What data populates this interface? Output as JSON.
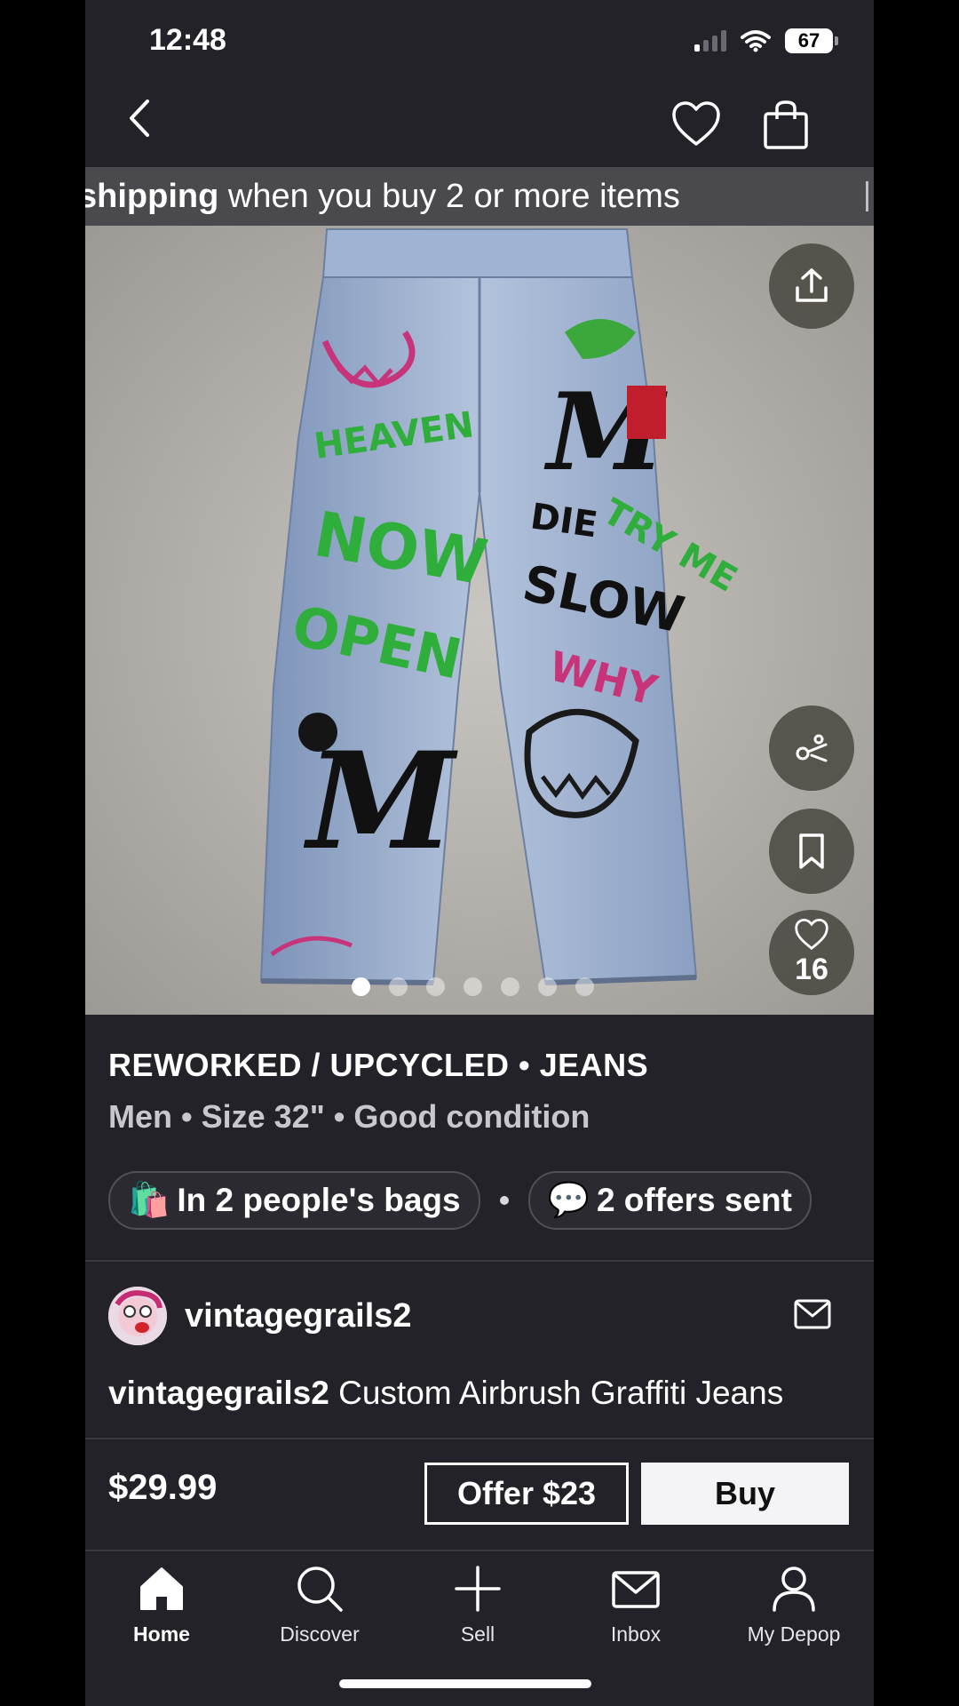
{
  "status": {
    "time": "12:48",
    "battery": "67"
  },
  "nav": {
    "back_icon": "chevron-left-icon",
    "like_icon": "heart-icon",
    "bag_icon": "shopping-bag-icon"
  },
  "promo": {
    "bold": "shipping",
    "text": " when you buy 2 or more items"
  },
  "hero": {
    "photo_count": 7,
    "active_index": 0,
    "like_count": "16",
    "actions": [
      "share-icon",
      "similar-items-icon",
      "save-icon",
      "heart-icon"
    ]
  },
  "product": {
    "title": "REWORKED / UPCYCLED • JEANS",
    "subtitle": "Men • Size 32\" • Good condition",
    "chip_bags_emoji": "🛍️",
    "chip_bags": "In 2 people's bags",
    "chip_offers_emoji": "💬",
    "chip_offers": "2 offers sent"
  },
  "seller": {
    "username": "vintagegrails2",
    "desc_user": "vintagegrails2",
    "desc_text": " Custom Airbrush Graffiti Jeans"
  },
  "buybar": {
    "price": "$29.99",
    "offer_label": "Offer $23",
    "buy_label": "Buy"
  },
  "tabs": [
    {
      "label": "Home",
      "icon": "home-icon",
      "active": true
    },
    {
      "label": "Discover",
      "icon": "search-icon",
      "active": false
    },
    {
      "label": "Sell",
      "icon": "plus-icon",
      "active": false
    },
    {
      "label": "Inbox",
      "icon": "mail-icon",
      "active": false
    },
    {
      "label": "My Depop",
      "icon": "profile-icon",
      "active": false
    }
  ],
  "colors": {
    "background": "#232229",
    "banner": "#4a4a4e",
    "accent": "#ffffff"
  }
}
